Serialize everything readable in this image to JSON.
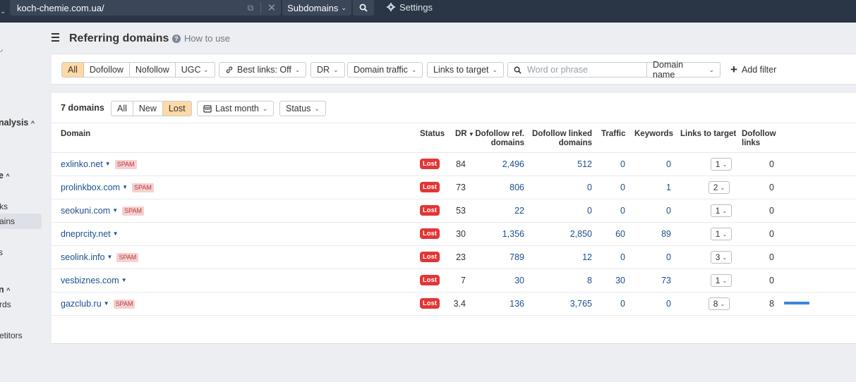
{
  "topbar": {
    "url": "koch-chemie.com.ua/",
    "mode": "Subdomains",
    "settings_label": "Settings"
  },
  "sidebar": {
    "items": [
      "nalysis",
      "e",
      "ks",
      "ains",
      "s",
      "n",
      "rds",
      "etitors"
    ]
  },
  "header": {
    "title": "Referring domains",
    "how_to": "How to use"
  },
  "filters": {
    "link_types": [
      "All",
      "Dofollow",
      "Nofollow",
      "UGC"
    ],
    "best_links": "Best links: Off",
    "dr": "DR",
    "domain_traffic": "Domain traffic",
    "links_to_target": "Links to target",
    "search_placeholder": "Word or phrase",
    "search_scope": "Domain name",
    "add_filter": "Add filter"
  },
  "results": {
    "count": "7 domains",
    "tabs": [
      "All",
      "New",
      "Lost"
    ],
    "active_tab": "Lost",
    "period": "Last month",
    "status_filter": "Status"
  },
  "columns": {
    "domain": "Domain",
    "status": "Status",
    "dr": "DR",
    "dofollow_ref_1": "Dofollow ref.",
    "dofollow_ref_2": "domains",
    "dofollow_linked_1": "Dofollow linked",
    "dofollow_linked_2": "domains",
    "traffic": "Traffic",
    "keywords": "Keywords",
    "links_to_target": "Links to target",
    "dofollow_links_1": "Dofollow",
    "dofollow_links_2": "links"
  },
  "rows": [
    {
      "domain": "exlinko.net",
      "spam": "SPAM",
      "status": "Lost",
      "dr": "84",
      "ref": "2,496",
      "linked": "512",
      "traffic": "0",
      "keywords": "0",
      "ltt": "1",
      "dofollow": "0"
    },
    {
      "domain": "prolinkbox.com",
      "spam": "SPAM",
      "status": "Lost",
      "dr": "73",
      "ref": "806",
      "linked": "0",
      "traffic": "0",
      "keywords": "1",
      "ltt": "2",
      "dofollow": "0"
    },
    {
      "domain": "seokuni.com",
      "spam": "SPAM",
      "status": "Lost",
      "dr": "53",
      "ref": "22",
      "linked": "0",
      "traffic": "0",
      "keywords": "0",
      "ltt": "1",
      "dofollow": "0"
    },
    {
      "domain": "dneprcity.net",
      "spam": "",
      "status": "Lost",
      "dr": "30",
      "ref": "1,356",
      "linked": "2,850",
      "traffic": "60",
      "keywords": "89",
      "ltt": "1",
      "dofollow": "0"
    },
    {
      "domain": "seolink.info",
      "spam": "SPAM",
      "status": "Lost",
      "dr": "23",
      "ref": "789",
      "linked": "12",
      "traffic": "0",
      "keywords": "0",
      "ltt": "3",
      "dofollow": "0"
    },
    {
      "domain": "vesbiznes.com",
      "spam": "",
      "status": "Lost",
      "dr": "7",
      "ref": "30",
      "linked": "8",
      "traffic": "30",
      "keywords": "73",
      "ltt": "1",
      "dofollow": "0"
    },
    {
      "domain": "gazclub.ru",
      "spam": "SPAM",
      "status": "Lost",
      "dr": "3.4",
      "ref": "136",
      "linked": "3,765",
      "traffic": "0",
      "keywords": "0",
      "ltt": "8",
      "dofollow": "8",
      "dofollow_bar": 1.0
    }
  ],
  "colors": {
    "topbar": "#2a3546",
    "active_segment": "#fdd9a6",
    "lost_badge": "#e23636",
    "link": "#1c4f8e",
    "spam_bg": "#f6d0d0",
    "bar": "#3d86d8"
  }
}
